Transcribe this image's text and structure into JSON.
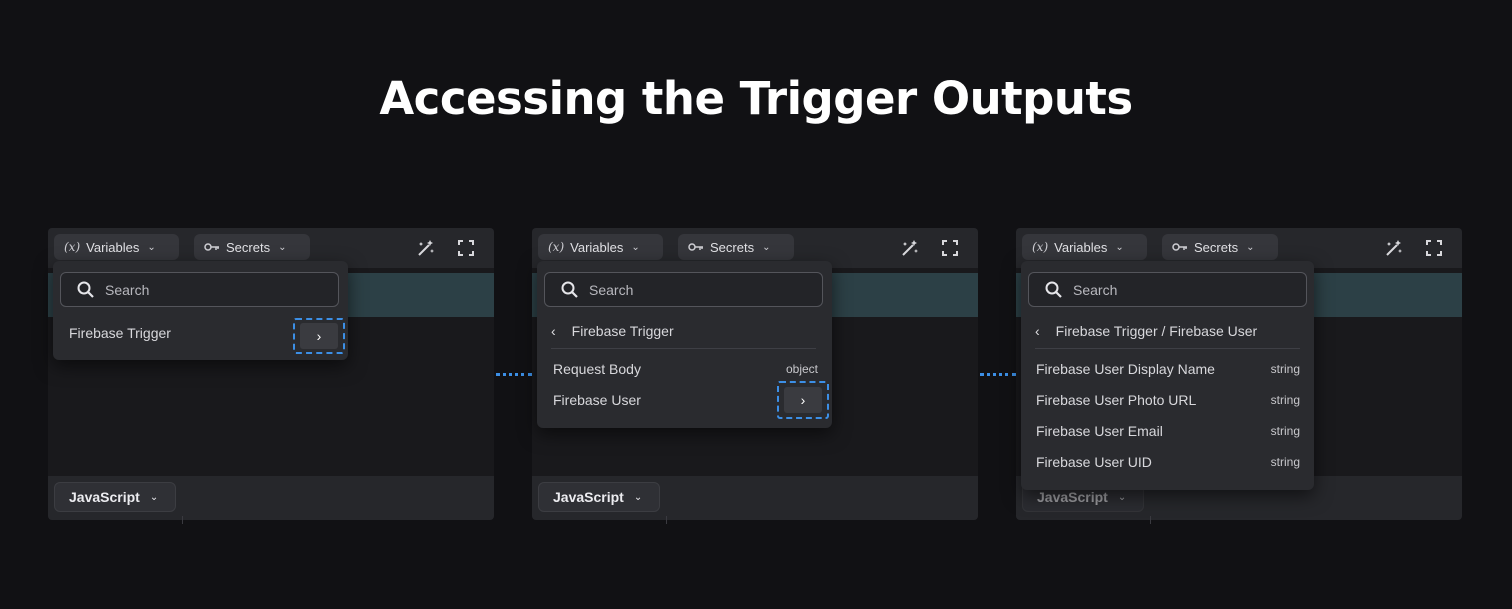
{
  "title": "Accessing the Trigger Outputs",
  "toolbar": {
    "variables_label": "Variables",
    "variables_prefix": "(x)",
    "secrets_label": "Secrets"
  },
  "search_placeholder": "Search",
  "language_label": "JavaScript",
  "panel1": {
    "item": "Firebase Trigger"
  },
  "panel2": {
    "breadcrumb": "Firebase Trigger",
    "rows": [
      {
        "label": "Request Body",
        "type": "object"
      },
      {
        "label": "Firebase User"
      }
    ]
  },
  "panel3": {
    "breadcrumb": "Firebase Trigger / Firebase User",
    "rows": [
      {
        "label": "Firebase User Display Name",
        "type": "string"
      },
      {
        "label": "Firebase User Photo URL",
        "type": "string"
      },
      {
        "label": "Firebase User Email",
        "type": "string"
      },
      {
        "label": "Firebase User UID",
        "type": "string"
      }
    ]
  },
  "colors": {
    "accent": "#3c8fe6",
    "background": "#111114"
  }
}
